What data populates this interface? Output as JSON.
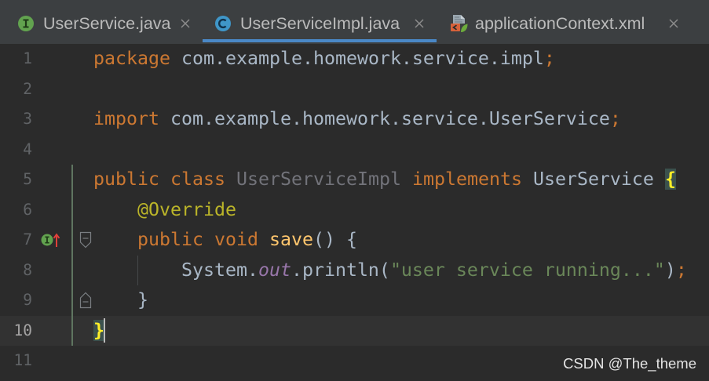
{
  "theme": {
    "tab_bar_bg": "#3c3f41",
    "editor_bg": "#2b2b2b",
    "active_tab_underline": "#4a88c7",
    "tab_text": "#bbbbbb",
    "keyword": "#cc7832",
    "plain": "#a9b7c6",
    "unused": "#72737a",
    "annotation": "#bbb529",
    "method_declaration": "#ffc66d",
    "static_field": "#9876aa",
    "string": "#6a8759",
    "brace_match_fg": "#ffef28",
    "brace_match_bg": "#3b514d",
    "line_number": "#606366",
    "current_line_number": "#a4a3a3",
    "current_line_bg": "#323232"
  },
  "tabs": [
    {
      "label": "UserService.java",
      "icon": "interface-icon",
      "active": false
    },
    {
      "label": "UserServiceImpl.java",
      "icon": "class-icon",
      "active": true
    },
    {
      "label": "applicationContext.xml",
      "icon": "xml-file-icon",
      "active": false
    }
  ],
  "editor": {
    "current_line": 10,
    "caret": {
      "line": 10,
      "column": 1
    },
    "line_numbers": [
      "1",
      "2",
      "3",
      "4",
      "5",
      "6",
      "7",
      "8",
      "9",
      "10",
      "11"
    ],
    "gutter_markers": [
      {
        "line": 7,
        "icon": "implementing-method-icon"
      }
    ],
    "fold_markers": [
      {
        "line": 7,
        "icon": "fold-start-icon"
      },
      {
        "line": 9,
        "icon": "fold-end-icon"
      }
    ],
    "vcs_changed_lines": [
      5,
      10
    ],
    "indent_guides": [
      {
        "column": 4,
        "from_line": 8,
        "to_line": 8
      }
    ],
    "lines": [
      {
        "indent": 0,
        "tokens": [
          "package",
          " com.example.homework.service.impl",
          ";"
        ]
      },
      {
        "indent": 0,
        "tokens": []
      },
      {
        "indent": 0,
        "tokens": [
          "import",
          " com.example.homework.service.UserService",
          ";"
        ]
      },
      {
        "indent": 0,
        "tokens": []
      },
      {
        "indent": 0,
        "tokens": [
          "public",
          " class",
          " UserServiceImpl",
          " implements",
          " UserService ",
          "{"
        ]
      },
      {
        "indent": 4,
        "tokens": [
          "@Override"
        ]
      },
      {
        "indent": 4,
        "tokens": [
          "public",
          " void",
          " save",
          "() {"
        ]
      },
      {
        "indent": 8,
        "tokens": [
          "System.",
          "out",
          ".println(",
          "\"user service running...\"",
          ")",
          ";"
        ]
      },
      {
        "indent": 4,
        "tokens": [
          "}"
        ]
      },
      {
        "indent": 0,
        "tokens": [
          "}"
        ]
      },
      {
        "indent": 0,
        "tokens": []
      }
    ]
  },
  "watermark": "CSDN @The_theme"
}
